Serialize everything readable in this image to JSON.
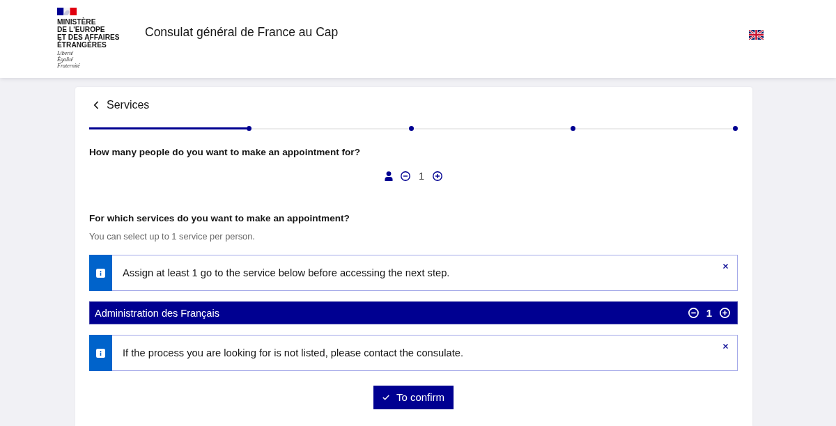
{
  "header": {
    "ministry": [
      "MINISTÈRE",
      "DE L'EUROPE",
      "ET DES AFFAIRES",
      "ÉTRANGÈRES"
    ],
    "motto": [
      "Liberté",
      "Égalité",
      "Fraternité"
    ],
    "site_title": "Consulat général de France au Cap"
  },
  "back_link": {
    "label": "Services"
  },
  "steps": [
    {
      "done": true
    },
    {
      "done": false
    },
    {
      "done": false
    },
    {
      "done": false
    }
  ],
  "people": {
    "question": "How many people do you want to make an appointment for?",
    "count": "1"
  },
  "services": {
    "question": "For which services do you want to make an appointment?",
    "hint": "You can select up to 1 service per person.",
    "blocks": [
      {
        "kind": "alert",
        "text": "Assign at least 1 go to the service below before accessing the next step."
      },
      {
        "kind": "service",
        "name": "Administration des Français",
        "count": "1"
      },
      {
        "kind": "alert",
        "text": "If the process you are looking for is not listed, please contact the consulate."
      }
    ]
  },
  "confirm_button": {
    "label": "To confirm"
  }
}
